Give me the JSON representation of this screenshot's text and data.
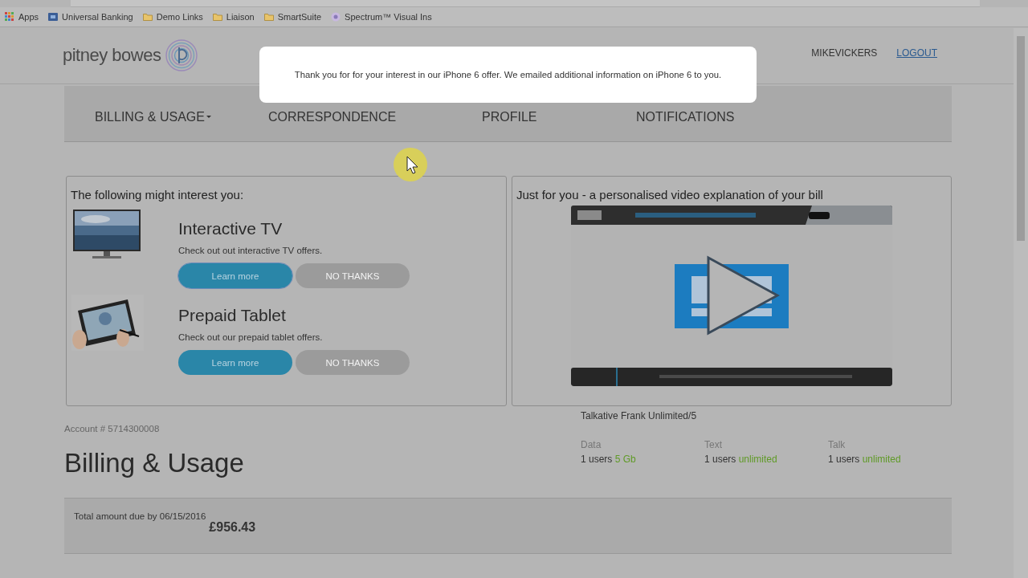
{
  "bookmarks": [
    {
      "kind": "apps",
      "label": "Apps"
    },
    {
      "kind": "site",
      "label": "Universal Banking"
    },
    {
      "kind": "folder",
      "label": "Demo Links"
    },
    {
      "kind": "folder",
      "label": "Liaison"
    },
    {
      "kind": "folder",
      "label": "SmartSuite"
    },
    {
      "kind": "spectrum",
      "label": "Spectrum™ Visual Ins"
    }
  ],
  "header": {
    "logo_text": "pitney bowes",
    "user": "MIKEVICKERS",
    "logout": "LOGOUT"
  },
  "nav": [
    {
      "label": "BILLING & USAGE",
      "dropdown": true
    },
    {
      "label": "CORRESPONDENCE",
      "dropdown": false
    },
    {
      "label": "PROFILE",
      "dropdown": false
    },
    {
      "label": "NOTIFICATIONS",
      "dropdown": false
    }
  ],
  "modal": {
    "message": "Thank you for for your interest in our iPhone 6 offer. We emailed additional information on iPhone 6 to you."
  },
  "offers": {
    "title": "The following might interest you:",
    "items": [
      {
        "kind": "tv",
        "title": "Interactive TV",
        "description": "Check out out interactive TV offers.",
        "primary": "Learn more",
        "secondary": "NO THANKS",
        "focused": true
      },
      {
        "kind": "tablet",
        "title": "Prepaid Tablet",
        "description": "Check out our prepaid tablet offers.",
        "primary": "Learn more",
        "secondary": "NO THANKS",
        "focused": false
      }
    ]
  },
  "video": {
    "title": "Just for you - a personalised video explanation of your bill"
  },
  "account": "Account # 5714300008",
  "heading": "Billing & Usage",
  "plan": {
    "name": "Talkative Frank Unlimited/5",
    "stats": [
      {
        "label": "Data",
        "users": "1 users",
        "amount": "5 Gb"
      },
      {
        "label": "Text",
        "users": "1 users",
        "amount": "unlimited"
      },
      {
        "label": "Talk",
        "users": "1 users",
        "amount": "unlimited"
      }
    ]
  },
  "total": {
    "label": "Total amount due by 06/15/2016",
    "amount": "£956.43"
  }
}
